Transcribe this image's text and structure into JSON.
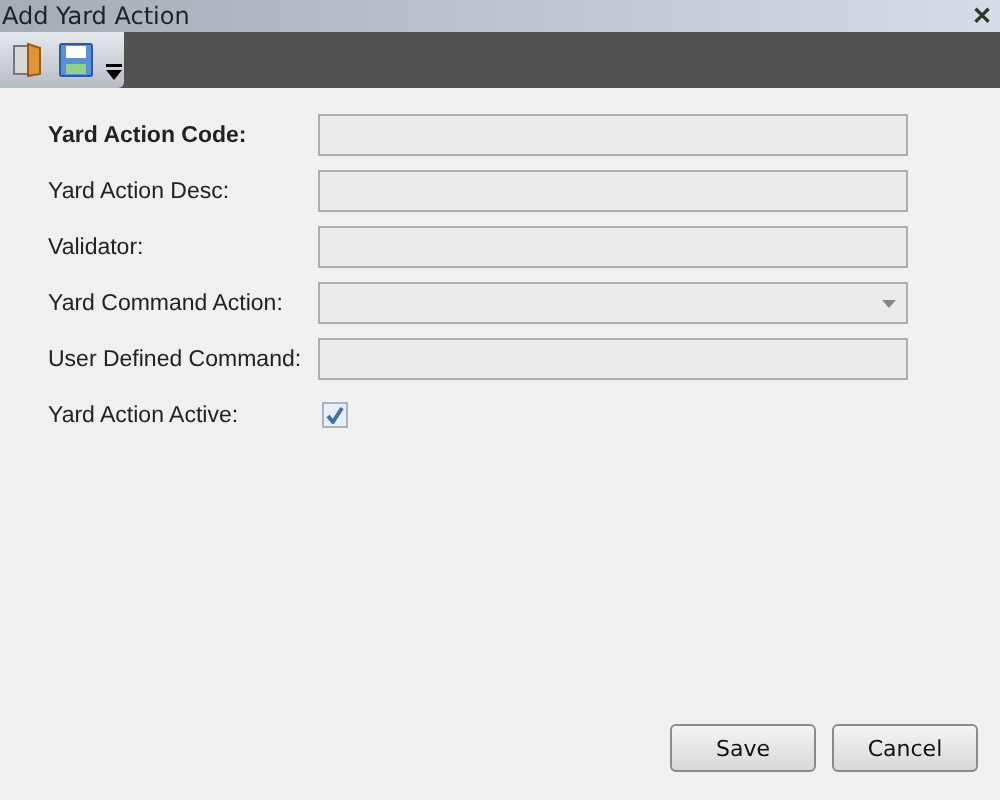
{
  "window": {
    "title": "Add Yard Action",
    "close": "✕"
  },
  "fields": [
    {
      "label": "Yard Action Code:",
      "kind": "text",
      "required": true
    },
    {
      "label": "Yard Action Desc:",
      "kind": "text",
      "required": false
    },
    {
      "label": "Validator:",
      "kind": "text",
      "required": false
    },
    {
      "label": "Yard Command Action:",
      "kind": "dropdown",
      "required": false
    },
    {
      "label": "User Defined Command:",
      "kind": "text",
      "required": false
    },
    {
      "label": "Yard Action Active:",
      "kind": "checkbox",
      "required": false,
      "checked": true
    }
  ],
  "buttons": [
    "Save",
    "Cancel"
  ]
}
